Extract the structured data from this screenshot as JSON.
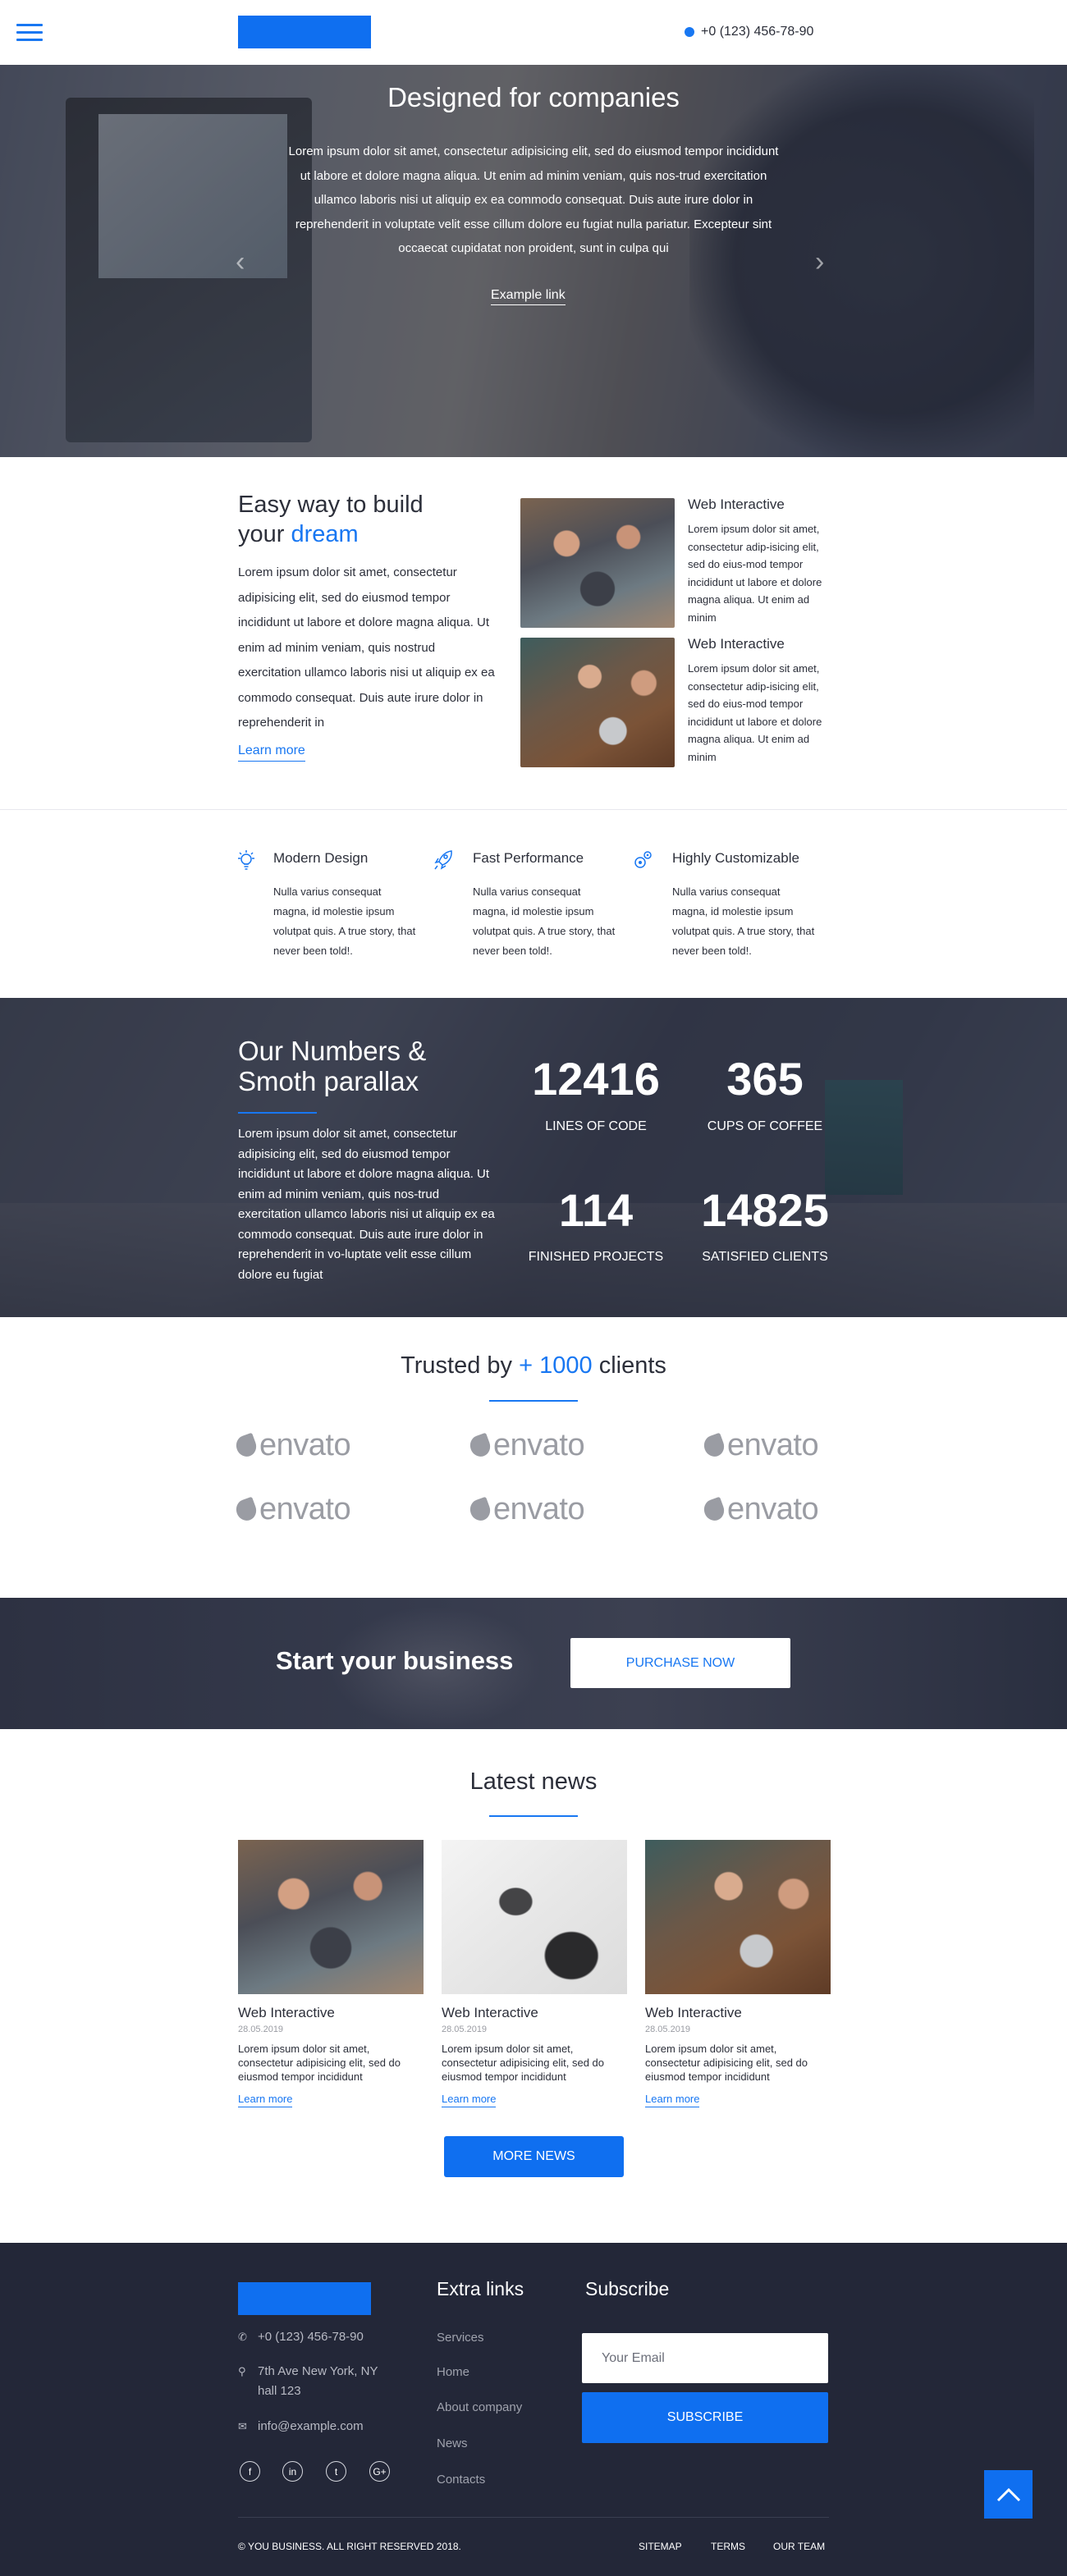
{
  "header": {
    "phone": "+0 (123) 456-78-90",
    "icons": {
      "menu": "hamburger-icon",
      "phone": "phone-icon"
    }
  },
  "hero": {
    "title": "Designed for companies",
    "text": "Lorem ipsum dolor sit amet, consectetur adipisicing elit, sed do eiusmod tempor incididunt ut labore et dolore magna aliqua. Ut enim ad minim veniam, quis nos-trud exercitation ullamco laboris nisi ut aliquip ex ea commodo consequat. Duis aute irure dolor in reprehenderit in voluptate velit esse cillum dolore eu fugiat nulla pariatur. Excepteur sint occaecat cupidatat non proident, sunt in culpa qui",
    "link": "Example link",
    "prev_arrow": "‹",
    "next_arrow": "›"
  },
  "about": {
    "title_line1": "Easy way to build",
    "title_your": "your",
    "title_accent": "dream",
    "text": "Lorem ipsum dolor sit amet, consectetur adipisicing elit, sed do eiusmod tempor incididunt ut labore et dolore magna aliqua. Ut enim ad minim veniam, quis nostrud exercitation ullamco laboris nisi ut aliquip ex ea commodo consequat. Duis aute irure dolor in reprehenderit in",
    "learn_more": "Learn more",
    "cards": [
      {
        "title": "Web Interactive",
        "text": "Lorem ipsum dolor sit amet, consectetur adip-isicing elit, sed do eius-mod tempor incididunt ut labore et dolore magna aliqua. Ut enim ad minim"
      },
      {
        "title": "Web Interactive",
        "text": "Lorem ipsum dolor sit amet, consectetur adip-isicing elit, sed do eius-mod tempor incididunt ut labore et dolore magna aliqua. Ut enim ad minim"
      }
    ]
  },
  "features": [
    {
      "title": "Modern Design",
      "icon": "lightbulb-icon",
      "text": "Nulla varius consequat magna, id molestie ipsum volutpat quis. A true story, that never been told!."
    },
    {
      "title": "Fast Performance",
      "icon": "rocket-icon",
      "text": "Nulla varius consequat magna, id molestie ipsum volutpat quis. A true story, that never been told!."
    },
    {
      "title": "Highly Customizable",
      "icon": "gears-icon",
      "text": "Nulla varius consequat magna, id molestie ipsum volutpat quis. A true story, that never been told!."
    }
  ],
  "numbers": {
    "title_line1": "Our Numbers &",
    "title_line2": "Smoth parallax",
    "text": "Lorem ipsum dolor sit amet, consectetur adipisicing elit, sed do eiusmod tempor incididunt ut labore et dolore magna aliqua. Ut enim ad minim veniam, quis nos-trud exercitation ullamco laboris nisi ut aliquip ex ea commodo consequat. Duis aute irure dolor in reprehenderit in vo-luptate velit esse cillum dolore eu fugiat",
    "stats": [
      {
        "value": "12416",
        "label": "LINES OF CODE"
      },
      {
        "value": "365",
        "label": "CUPS OF COFFEE"
      },
      {
        "value": "114",
        "label": "FINISHED PROJECTS"
      },
      {
        "value": "14825",
        "label": "SATISFIED CLIENTS"
      }
    ]
  },
  "trusted": {
    "prefix": "Trusted by",
    "accent": "+ 1000",
    "suffix": "clients",
    "logos": [
      "envato",
      "envato",
      "envato",
      "envato",
      "envato",
      "envato"
    ]
  },
  "cta": {
    "title": "Start your business",
    "button": "PURCHASE NOW"
  },
  "news": {
    "title": "Latest news",
    "items": [
      {
        "title": "Web Interactive",
        "date": "28.05.2019",
        "text": "Lorem ipsum dolor sit amet, consectetur adipisicing elit, sed do eiusmod tempor incididunt",
        "more": "Learn more"
      },
      {
        "title": "Web Interactive",
        "date": "28.05.2019",
        "text": "Lorem ipsum dolor sit amet, consectetur adipisicing elit, sed do eiusmod tempor incididunt",
        "more": "Learn more"
      },
      {
        "title": "Web Interactive",
        "date": "28.05.2019",
        "text": "Lorem ipsum dolor sit amet, consectetur adipisicing elit, sed do eiusmod tempor incididunt",
        "more": "Learn more"
      }
    ],
    "more_button": "MORE NEWS"
  },
  "footer": {
    "phone": "+0 (123) 456-78-90",
    "address_line1": "7th Ave New York, NY",
    "address_line2": "hall 123",
    "email": "info@example.com",
    "social": [
      "facebook-icon",
      "linkedin-icon",
      "twitter-icon",
      "google-plus-icon"
    ],
    "social_glyphs": [
      "f",
      "in",
      "t",
      "G+"
    ],
    "extra_title": "Extra links",
    "links": [
      "Services",
      "Home",
      "About company",
      "News",
      "Contacts"
    ],
    "subscribe_title": "Subscribe",
    "email_placeholder": "Your Email",
    "subscribe_button": "SUBSCRIBE",
    "copyright": "© YOU BUSINESS. ALL RIGHT RESERVED 2018.",
    "bottom_links": [
      "SITEMAP",
      "TERMS",
      "OUR TEAM"
    ]
  },
  "colors": {
    "accent": "#1877f2",
    "button": "#0f6ff0",
    "footer_bg": "#232738",
    "text": "#2c2f3a"
  }
}
